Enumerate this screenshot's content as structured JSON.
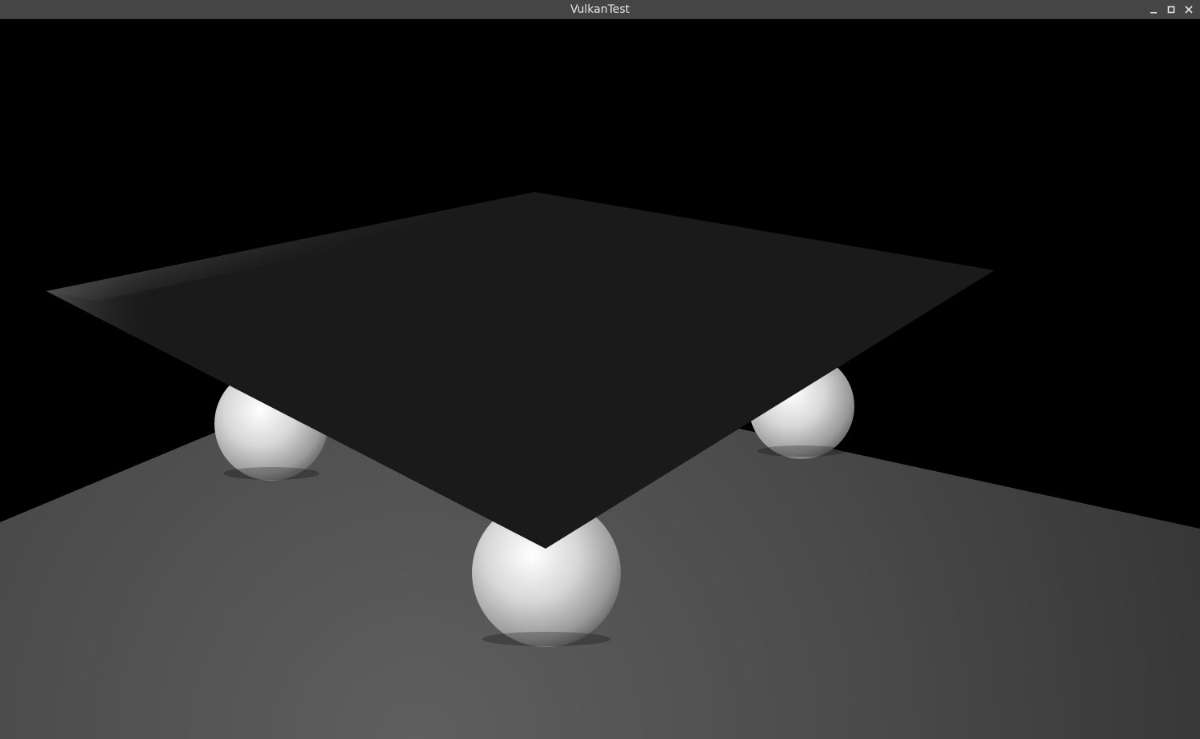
{
  "window": {
    "title": "VulkanTest",
    "controls": [
      {
        "name": "minimize",
        "icon": "minimize-icon"
      },
      {
        "name": "maximize",
        "icon": "maximize-icon"
      },
      {
        "name": "close",
        "icon": "close-icon"
      }
    ]
  },
  "scene": {
    "background_color": "#000000",
    "floor_color": "#4a4a4a",
    "plane_color": "#1a1a1a",
    "sphere_color": "#e0e0e0",
    "sphere_count": 3
  }
}
